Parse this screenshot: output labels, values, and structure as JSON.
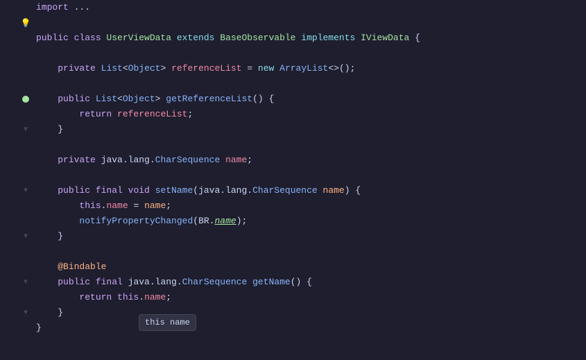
{
  "editor": {
    "background": "#1e1e2e",
    "tooltip": {
      "text": "this name"
    }
  },
  "lines": [
    {
      "ln": "",
      "glyph": "",
      "indent": 0,
      "tokens": [
        {
          "t": "import",
          "c": "kw"
        },
        {
          "t": " ...",
          "c": "plain"
        }
      ]
    },
    {
      "ln": "",
      "glyph": "lightbulb",
      "indent": 4,
      "tokens": []
    },
    {
      "ln": "",
      "glyph": "",
      "indent": 0,
      "tokens": [
        {
          "t": "public ",
          "c": "kw"
        },
        {
          "t": "class ",
          "c": "kw"
        },
        {
          "t": "UserViewData",
          "c": "classname"
        },
        {
          "t": " extends ",
          "c": "kw2"
        },
        {
          "t": "BaseObservable",
          "c": "classname"
        },
        {
          "t": " implements ",
          "c": "kw2"
        },
        {
          "t": "IViewData",
          "c": "classname"
        },
        {
          "t": " {",
          "c": "plain"
        }
      ]
    },
    {
      "ln": "",
      "glyph": "",
      "indent": 0,
      "tokens": []
    },
    {
      "ln": "",
      "glyph": "",
      "indent": 4,
      "tokens": [
        {
          "t": "private ",
          "c": "kw"
        },
        {
          "t": "List",
          "c": "type"
        },
        {
          "t": "<",
          "c": "plain"
        },
        {
          "t": "Object",
          "c": "type"
        },
        {
          "t": "> ",
          "c": "plain"
        },
        {
          "t": "referenceList",
          "c": "field"
        },
        {
          "t": " = ",
          "c": "plain"
        },
        {
          "t": "new ",
          "c": "kw2"
        },
        {
          "t": "ArrayList",
          "c": "type"
        },
        {
          "t": "<>",
          "c": "plain"
        },
        {
          "t": "();",
          "c": "plain"
        }
      ]
    },
    {
      "ln": "",
      "glyph": "",
      "indent": 0,
      "tokens": []
    },
    {
      "ln": "",
      "glyph": "circle",
      "indent": 4,
      "tokens": [
        {
          "t": "public ",
          "c": "kw"
        },
        {
          "t": "List",
          "c": "type"
        },
        {
          "t": "<",
          "c": "plain"
        },
        {
          "t": "Object",
          "c": "type"
        },
        {
          "t": "> ",
          "c": "plain"
        },
        {
          "t": "getReferenceList",
          "c": "method"
        },
        {
          "t": "() {",
          "c": "plain"
        }
      ]
    },
    {
      "ln": "",
      "glyph": "",
      "indent": 8,
      "tokens": [
        {
          "t": "return ",
          "c": "kw"
        },
        {
          "t": "referenceList",
          "c": "field"
        },
        {
          "t": ";",
          "c": "plain"
        }
      ]
    },
    {
      "ln": "",
      "glyph": "fold",
      "indent": 4,
      "tokens": [
        {
          "t": "}",
          "c": "plain"
        }
      ]
    },
    {
      "ln": "",
      "glyph": "",
      "indent": 0,
      "tokens": []
    },
    {
      "ln": "",
      "glyph": "",
      "indent": 4,
      "tokens": [
        {
          "t": "private ",
          "c": "kw"
        },
        {
          "t": "java.lang.",
          "c": "plain"
        },
        {
          "t": "CharSequence",
          "c": "type"
        },
        {
          "t": " name",
          "c": "field"
        },
        {
          "t": ";",
          "c": "plain"
        }
      ]
    },
    {
      "ln": "",
      "glyph": "",
      "indent": 0,
      "tokens": []
    },
    {
      "ln": "",
      "glyph": "fold",
      "indent": 4,
      "tokens": [
        {
          "t": "public ",
          "c": "kw"
        },
        {
          "t": "final ",
          "c": "kw"
        },
        {
          "t": "void ",
          "c": "kw"
        },
        {
          "t": "setName",
          "c": "method"
        },
        {
          "t": "(",
          "c": "plain"
        },
        {
          "t": "java.lang.",
          "c": "plain"
        },
        {
          "t": "CharSequence",
          "c": "type"
        },
        {
          "t": " name",
          "c": "param"
        },
        {
          "t": ") {",
          "c": "plain"
        }
      ]
    },
    {
      "ln": "",
      "glyph": "",
      "indent": 8,
      "tokens": [
        {
          "t": "this",
          "c": "kw"
        },
        {
          "t": ".",
          "c": "plain"
        },
        {
          "t": "name",
          "c": "field"
        },
        {
          "t": " = ",
          "c": "plain"
        },
        {
          "t": "name",
          "c": "param"
        },
        {
          "t": ";",
          "c": "plain"
        }
      ]
    },
    {
      "ln": "",
      "glyph": "",
      "indent": 8,
      "tokens": [
        {
          "t": "notifyPropertyChanged",
          "c": "method"
        },
        {
          "t": "(",
          "c": "plain"
        },
        {
          "t": "BR.",
          "c": "plain"
        },
        {
          "t": "name",
          "c": "br-ref"
        },
        {
          "t": ");",
          "c": "plain"
        }
      ]
    },
    {
      "ln": "",
      "glyph": "fold",
      "indent": 4,
      "tokens": [
        {
          "t": "}",
          "c": "plain"
        }
      ]
    },
    {
      "ln": "",
      "glyph": "",
      "indent": 0,
      "tokens": []
    },
    {
      "ln": "",
      "glyph": "",
      "indent": 4,
      "tokens": [
        {
          "t": "@Bindable",
          "c": "annotation"
        }
      ]
    },
    {
      "ln": "",
      "glyph": "fold",
      "indent": 4,
      "tokens": [
        {
          "t": "public ",
          "c": "kw"
        },
        {
          "t": "final ",
          "c": "kw"
        },
        {
          "t": "java.lang.",
          "c": "plain"
        },
        {
          "t": "CharSequence",
          "c": "type"
        },
        {
          "t": " getName",
          "c": "method"
        },
        {
          "t": "() {",
          "c": "plain"
        }
      ]
    },
    {
      "ln": "",
      "glyph": "",
      "indent": 8,
      "tokens": [
        {
          "t": "return ",
          "c": "kw"
        },
        {
          "t": "this",
          "c": "kw"
        },
        {
          "t": ".",
          "c": "plain"
        },
        {
          "t": "name",
          "c": "field"
        },
        {
          "t": ";",
          "c": "plain"
        }
      ]
    },
    {
      "ln": "",
      "glyph": "fold",
      "indent": 4,
      "tokens": [
        {
          "t": "}",
          "c": "plain"
        }
      ]
    },
    {
      "ln": "",
      "glyph": "",
      "indent": 0,
      "tokens": [
        {
          "t": "}",
          "c": "plain"
        }
      ]
    }
  ]
}
